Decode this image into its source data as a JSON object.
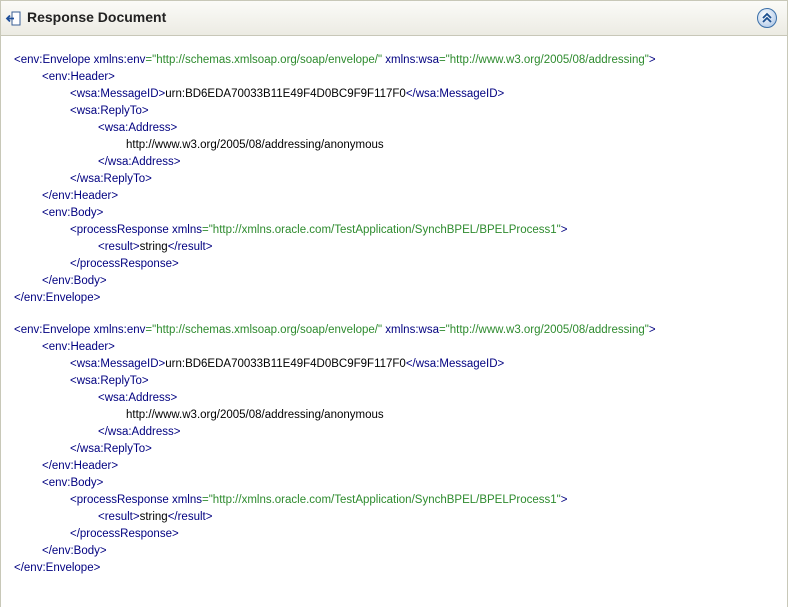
{
  "panel": {
    "title": "Response Document",
    "back_icon": "back-arrow-icon",
    "collapse_icon": "double-chevron-up-icon"
  },
  "colors": {
    "tag": "#000080",
    "attribute_value": "#2e8b2e",
    "text": "#000000",
    "header_bg": "#ecebe3"
  },
  "documents": [
    {
      "lines": [
        {
          "indent": 0,
          "segments": [
            {
              "t": "<env:Envelope ",
              "c": "tag"
            },
            {
              "t": "xmlns:env",
              "c": "attr"
            },
            {
              "t": "=\"http://schemas.xmlsoap.org/soap/envelope/\"",
              "c": "val"
            },
            {
              "t": " xmlns:wsa",
              "c": "attr"
            },
            {
              "t": "=\"http://www.w3.org/2005/08/addressing\"",
              "c": "val"
            },
            {
              "t": ">",
              "c": "tag"
            }
          ]
        },
        {
          "indent": 1,
          "segments": [
            {
              "t": "<env:Header>",
              "c": "tag"
            }
          ]
        },
        {
          "indent": 2,
          "segments": [
            {
              "t": "<wsa:MessageID>",
              "c": "tag"
            },
            {
              "t": "urn:BD6EDA70033B11E49F4D0BC9F9F117F0",
              "c": "txt"
            },
            {
              "t": "</wsa:MessageID>",
              "c": "tag"
            }
          ]
        },
        {
          "indent": 2,
          "segments": [
            {
              "t": "<wsa:ReplyTo>",
              "c": "tag"
            }
          ]
        },
        {
          "indent": 3,
          "segments": [
            {
              "t": "<wsa:Address>",
              "c": "tag"
            }
          ]
        },
        {
          "indent": 4,
          "segments": [
            {
              "t": "http://www.w3.org/2005/08/addressing/anonymous",
              "c": "txt"
            }
          ]
        },
        {
          "indent": 3,
          "segments": [
            {
              "t": "</wsa:Address>",
              "c": "tag"
            }
          ]
        },
        {
          "indent": 2,
          "segments": [
            {
              "t": "</wsa:ReplyTo>",
              "c": "tag"
            }
          ]
        },
        {
          "indent": 1,
          "segments": [
            {
              "t": "</env:Header>",
              "c": "tag"
            }
          ]
        },
        {
          "indent": 1,
          "segments": [
            {
              "t": "<env:Body>",
              "c": "tag"
            }
          ]
        },
        {
          "indent": 2,
          "segments": [
            {
              "t": "<processResponse ",
              "c": "tag"
            },
            {
              "t": "xmlns",
              "c": "attr"
            },
            {
              "t": "=\"http://xmlns.oracle.com/TestApplication/SynchBPEL/BPELProcess1\"",
              "c": "val"
            },
            {
              "t": ">",
              "c": "tag"
            }
          ]
        },
        {
          "indent": 3,
          "segments": [
            {
              "t": "<result>",
              "c": "tag"
            },
            {
              "t": "string",
              "c": "txt"
            },
            {
              "t": "</result>",
              "c": "tag"
            }
          ]
        },
        {
          "indent": 2,
          "segments": [
            {
              "t": "</processResponse>",
              "c": "tag"
            }
          ]
        },
        {
          "indent": 1,
          "segments": [
            {
              "t": "</env:Body>",
              "c": "tag"
            }
          ]
        },
        {
          "indent": 0,
          "segments": [
            {
              "t": "</env:Envelope>",
              "c": "tag"
            }
          ]
        }
      ]
    },
    {
      "lines": [
        {
          "indent": 0,
          "segments": [
            {
              "t": "<env:Envelope ",
              "c": "tag"
            },
            {
              "t": "xmlns:env",
              "c": "attr"
            },
            {
              "t": "=\"http://schemas.xmlsoap.org/soap/envelope/\"",
              "c": "val"
            },
            {
              "t": " xmlns:wsa",
              "c": "attr"
            },
            {
              "t": "=\"http://www.w3.org/2005/08/addressing\"",
              "c": "val"
            },
            {
              "t": ">",
              "c": "tag"
            }
          ]
        },
        {
          "indent": 1,
          "segments": [
            {
              "t": "<env:Header>",
              "c": "tag"
            }
          ]
        },
        {
          "indent": 2,
          "segments": [
            {
              "t": "<wsa:MessageID>",
              "c": "tag"
            },
            {
              "t": "urn:BD6EDA70033B11E49F4D0BC9F9F117F0",
              "c": "txt"
            },
            {
              "t": "</wsa:MessageID>",
              "c": "tag"
            }
          ]
        },
        {
          "indent": 2,
          "segments": [
            {
              "t": "<wsa:ReplyTo>",
              "c": "tag"
            }
          ]
        },
        {
          "indent": 3,
          "segments": [
            {
              "t": "<wsa:Address>",
              "c": "tag"
            }
          ]
        },
        {
          "indent": 4,
          "segments": [
            {
              "t": "http://www.w3.org/2005/08/addressing/anonymous",
              "c": "txt"
            }
          ]
        },
        {
          "indent": 3,
          "segments": [
            {
              "t": "</wsa:Address>",
              "c": "tag"
            }
          ]
        },
        {
          "indent": 2,
          "segments": [
            {
              "t": "</wsa:ReplyTo>",
              "c": "tag"
            }
          ]
        },
        {
          "indent": 1,
          "segments": [
            {
              "t": "</env:Header>",
              "c": "tag"
            }
          ]
        },
        {
          "indent": 1,
          "segments": [
            {
              "t": "<env:Body>",
              "c": "tag"
            }
          ]
        },
        {
          "indent": 2,
          "segments": [
            {
              "t": "<processResponse ",
              "c": "tag"
            },
            {
              "t": "xmlns",
              "c": "attr"
            },
            {
              "t": "=\"http://xmlns.oracle.com/TestApplication/SynchBPEL/BPELProcess1\"",
              "c": "val"
            },
            {
              "t": ">",
              "c": "tag"
            }
          ]
        },
        {
          "indent": 3,
          "segments": [
            {
              "t": "<result>",
              "c": "tag"
            },
            {
              "t": "string",
              "c": "txt"
            },
            {
              "t": "</result>",
              "c": "tag"
            }
          ]
        },
        {
          "indent": 2,
          "segments": [
            {
              "t": "</processResponse>",
              "c": "tag"
            }
          ]
        },
        {
          "indent": 1,
          "segments": [
            {
              "t": "</env:Body>",
              "c": "tag"
            }
          ]
        },
        {
          "indent": 0,
          "segments": [
            {
              "t": "</env:Envelope>",
              "c": "tag"
            }
          ]
        }
      ]
    }
  ]
}
